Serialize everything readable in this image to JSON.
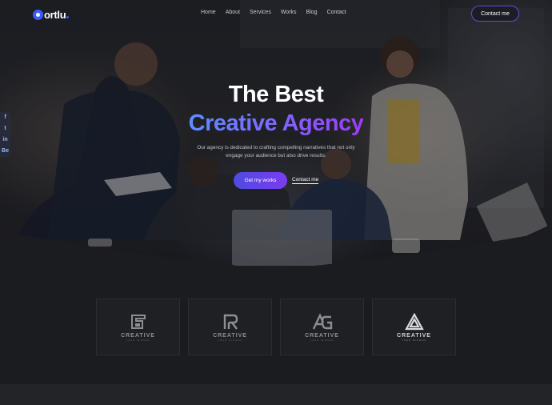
{
  "header": {
    "logo_text": "ortlu",
    "nav": [
      "Home",
      "About",
      "Services",
      "Works",
      "Blog",
      "Contact"
    ],
    "contact_button": "Contact me"
  },
  "social": [
    "f",
    "t",
    "in",
    "Be"
  ],
  "hero": {
    "title_line1": "The Best",
    "title_line2": "Creative Agency",
    "description": "Our agency is dedicated to crafting compelling narratives that not only engage your audience but also drive results.",
    "primary_button": "Get my works",
    "secondary_link": "Contact me"
  },
  "brands": [
    {
      "icon": "gs-monogram-icon",
      "name": "CREATIVE",
      "tag": "YOUR SLOGAN"
    },
    {
      "icon": "r-monogram-icon",
      "name": "CREATIVE",
      "tag": "YOUR SLOGAN"
    },
    {
      "icon": "ag-monogram-icon",
      "name": "CREATIVE",
      "tag": "YOUR SLOGAN"
    },
    {
      "icon": "triangle-knot-icon",
      "name": "CREATIVE",
      "tag": "YOUR SLOGAN"
    }
  ],
  "colors": {
    "accent": "#5a4fd8",
    "gradient_start": "#5f8cff",
    "gradient_end": "#9b3cf5",
    "background": "#1b1c1f"
  }
}
